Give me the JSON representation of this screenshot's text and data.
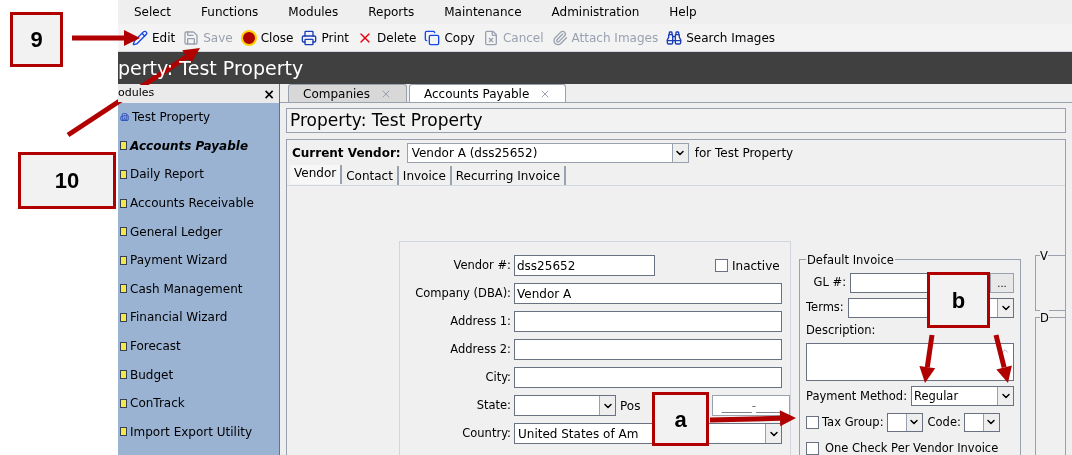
{
  "menu": [
    "Select",
    "Functions",
    "Modules",
    "Reports",
    "Maintenance",
    "Administration",
    "Help"
  ],
  "toolbar": [
    {
      "kind": "edit",
      "label": "Edit",
      "disabled": false
    },
    {
      "kind": "save",
      "label": "Save",
      "disabled": true
    },
    {
      "kind": "close",
      "label": "Close",
      "disabled": false
    },
    {
      "kind": "print",
      "label": "Print",
      "disabled": false
    },
    {
      "kind": "delete",
      "label": "Delete",
      "disabled": false
    },
    {
      "kind": "copy",
      "label": "Copy",
      "disabled": false
    },
    {
      "kind": "cancel",
      "label": "Cancel",
      "disabled": true
    },
    {
      "kind": "attach",
      "label": "Attach Images",
      "disabled": true
    },
    {
      "kind": "search",
      "label": "Search Images",
      "disabled": false
    }
  ],
  "title": "perty: Test Property",
  "sidebar": {
    "header": "odules",
    "close": "×",
    "items": [
      {
        "kind": "property",
        "label": "Test Property",
        "selected": false
      },
      {
        "kind": "module",
        "label": "Accounts Payable",
        "selected": true
      },
      {
        "kind": "module",
        "label": "Daily Report",
        "selected": false
      },
      {
        "kind": "module",
        "label": "Accounts Receivable",
        "selected": false
      },
      {
        "kind": "module",
        "label": "General Ledger",
        "selected": false
      },
      {
        "kind": "module",
        "label": "Payment Wizard",
        "selected": false
      },
      {
        "kind": "module",
        "label": "Cash Management",
        "selected": false
      },
      {
        "kind": "module",
        "label": "Financial Wizard",
        "selected": false
      },
      {
        "kind": "module",
        "label": "Forecast",
        "selected": false
      },
      {
        "kind": "module",
        "label": "Budget",
        "selected": false
      },
      {
        "kind": "module",
        "label": "ConTrack",
        "selected": false
      },
      {
        "kind": "module",
        "label": "Import Export Utility",
        "selected": false
      }
    ]
  },
  "tabs": [
    {
      "label": "Companies",
      "selected": false
    },
    {
      "label": "Accounts Payable",
      "selected": true
    }
  ],
  "heading": "Property: Test Property",
  "vendor_bar": {
    "label": "Current Vendor:",
    "value": "Vendor A (dss25652)",
    "suffix": "for Test Property"
  },
  "subtabs": [
    {
      "label": "Vendor",
      "selected": true
    },
    {
      "label": "Contact",
      "selected": false
    },
    {
      "label": "Invoice",
      "selected": false
    },
    {
      "label": "Recurring Invoice",
      "selected": false
    }
  ],
  "vendor_form": {
    "inactive": {
      "label": "Inactive",
      "checked": false
    },
    "fields": [
      {
        "kind": "text",
        "label": "Vendor #:",
        "value": "dss25652"
      },
      {
        "kind": "text",
        "label": "Company (DBA):",
        "value": "Vendor A"
      },
      {
        "kind": "text",
        "label": "Address 1:"
      },
      {
        "kind": "text",
        "label": "Address 2:"
      },
      {
        "kind": "text",
        "label": "City:"
      },
      {
        "kind": "state",
        "label": "State:",
        "postal_label": "Pos",
        "postal_value": "_____-____"
      },
      {
        "kind": "select",
        "label": "Country:",
        "value": "United States of Am"
      }
    ]
  },
  "default_invoice": {
    "title": "Default Invoice",
    "gl_label": "GL #:",
    "gl_button": "...",
    "terms_label": "Terms:",
    "description_label": "Description:",
    "payment_label": "Payment Method:",
    "payment_value": "Regular",
    "tax_group": {
      "label": "Tax Group:",
      "checked": false
    },
    "code_label": "Code:",
    "one_check": {
      "label": "One Check Per Vendor Invoice",
      "checked": false
    }
  },
  "right_groups": [
    "V",
    "D"
  ],
  "callouts": [
    "9",
    "10",
    "a",
    "b"
  ]
}
